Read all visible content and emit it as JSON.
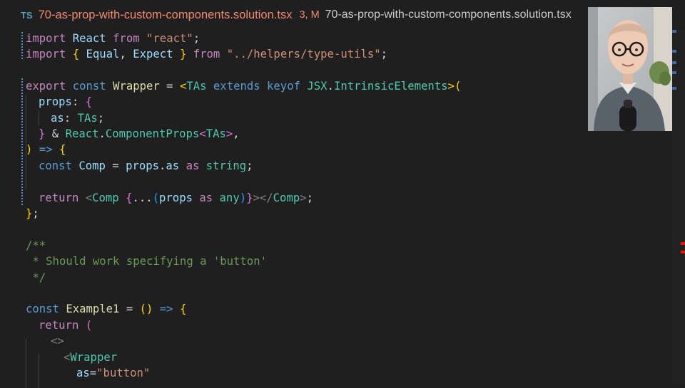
{
  "tab": {
    "language_badge": "TS",
    "filename": "70-as-prop-with-custom-components.solution.tsx",
    "status": "3, M",
    "breadcrumb": "70-as-prop-with-custom-components.solution.tsx"
  },
  "code": {
    "l1": [
      "import",
      " ",
      "React",
      " ",
      "from",
      " ",
      "\"react\"",
      ";"
    ],
    "l2": [
      "import",
      " ",
      "{",
      " ",
      "Equal",
      ", ",
      "Expect",
      " ",
      "}",
      " ",
      "from",
      " ",
      "\"../helpers/type-utils\"",
      ";"
    ],
    "l4": [
      "export",
      " ",
      "const",
      " ",
      "Wrapper",
      " = ",
      "<",
      "TAs",
      " ",
      "extends",
      " ",
      "keyof",
      " ",
      "JSX",
      ".",
      "IntrinsicElements",
      ">",
      "("
    ],
    "l5": [
      "props",
      ": ",
      "{"
    ],
    "l6": [
      "as",
      ": ",
      "TAs",
      ";"
    ],
    "l7": [
      "}",
      " & ",
      "React",
      ".",
      "ComponentProps",
      "<",
      "TAs",
      ">",
      ","
    ],
    "l8": [
      ")",
      " ",
      "=>",
      " ",
      "{"
    ],
    "l9": [
      "const",
      " ",
      "Comp",
      " = ",
      "props",
      ".",
      "as",
      " ",
      "as",
      " ",
      "string",
      ";"
    ],
    "l11": [
      "return",
      " ",
      "<",
      "Comp",
      " ",
      "{",
      "...",
      "(",
      "props",
      " ",
      "as",
      " ",
      "any",
      ")",
      "}",
      "></",
      "Comp",
      ">",
      ";"
    ],
    "l12": [
      "}",
      ";"
    ],
    "l14": "/**",
    "l15": " * Should work specifying a 'button'",
    "l16": " */",
    "l18": [
      "const",
      " ",
      "Example1",
      " = ",
      "(",
      ")",
      " ",
      "=>",
      " ",
      "{"
    ],
    "l19": [
      "return",
      " ",
      "("
    ],
    "l20": "<>",
    "l21": [
      "<",
      "Wrapper"
    ],
    "l22": [
      "as",
      "=",
      "\"button\""
    ]
  },
  "colors": {
    "background": "#1f1f1f",
    "tab_modified": "#f48771",
    "keyword": "#c586c0",
    "storage": "#569cd6",
    "variable": "#9cdcfe",
    "function": "#dcdcaa",
    "type": "#4ec9b0",
    "string": "#ce9178",
    "comment": "#6a9955"
  },
  "icons": {
    "ts": "typescript-file-icon",
    "webcam": "presenter-webcam-overlay"
  }
}
